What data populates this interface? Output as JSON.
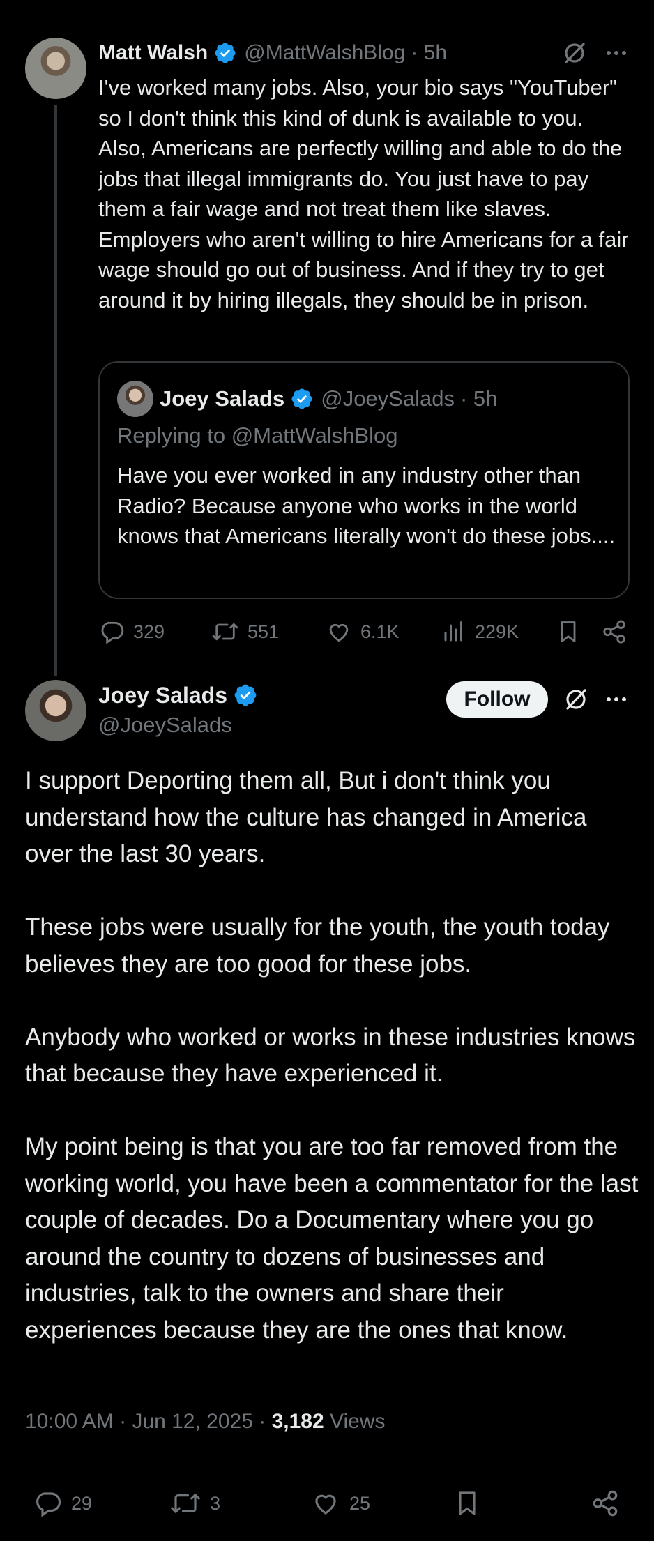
{
  "parent_tweet": {
    "name": "Matt Walsh",
    "handle": "@MattWalshBlog",
    "time": "· 5h",
    "body": "I've worked many jobs. Also, your bio says \"YouTuber\" so I don't think this kind of dunk is available to you. Also, Americans are perfectly willing and able to do the jobs that illegal immigrants do. You just have to pay them a fair wage and not treat them like slaves. Employers who aren't willing to hire Americans for a fair wage should go out of business. And if they try to get around it by hiring illegals, they should be in prison.",
    "stats": {
      "replies": "329",
      "reposts": "551",
      "likes": "6.1K",
      "views": "229K"
    }
  },
  "quoted_tweet": {
    "name": "Joey Salads",
    "handle": "@JoeySalads",
    "time": "· 5h",
    "replying_to": "Replying to @MattWalshBlog",
    "body": "Have you ever worked in any industry other than Radio? Because anyone who works in the world knows that Americans literally won't do these jobs...."
  },
  "main_tweet": {
    "name": "Joey Salads",
    "handle": "@JoeySalads",
    "follow_label": "Follow",
    "paragraphs": [
      "I support Deporting them all, But i don't think you understand how the culture has changed in America over the last 30 years.",
      "These jobs were usually for the youth, the youth today believes they are too good for these jobs.",
      "Anybody who worked or works in these industries knows that because they have experienced it.",
      "My point being is that you are too far removed from the working world, you have been a commentator for the last couple of decades. Do a Documentary where you go around the country to dozens of businesses and industries, talk to the owners and share their experiences because they are the ones that know."
    ],
    "timestamp": "10:00 AM · Jun 12, 2025 · ",
    "views_count": "3,182",
    "views_label": " Views",
    "stats": {
      "replies": "29",
      "reposts": "3",
      "likes": "25"
    }
  },
  "colors": {
    "background": "#000000",
    "text": "#e7e9ea",
    "muted": "#71767b",
    "verified": "#1d9bf0",
    "border": "#333639"
  }
}
